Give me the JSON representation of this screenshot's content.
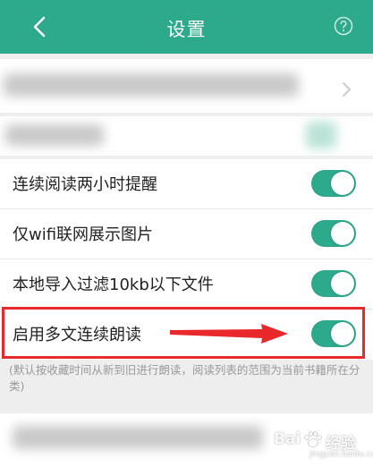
{
  "header": {
    "title": "设置",
    "back_icon": "chevron-left-icon",
    "help_icon": "question-circle-icon",
    "color": "#2daa8c"
  },
  "toggles": [
    {
      "label": "连续阅读两小时提醒",
      "on": true
    },
    {
      "label": "仅wifi联网展示图片",
      "on": true
    },
    {
      "label": "本地导入过滤10kb以下文件",
      "on": true
    },
    {
      "label": "启用多文连续朗读",
      "on": true
    }
  ],
  "note": "(默认按收藏时间从新到旧进行朗读，阅读列表的范围为当前书籍所在分类)",
  "watermark": {
    "left_text": "Bai",
    "right_text": "经验",
    "sub_text": "jingyan.baidu.com"
  },
  "colors": {
    "toggle_on": "#2daa8c",
    "highlight": "#e8282b"
  }
}
